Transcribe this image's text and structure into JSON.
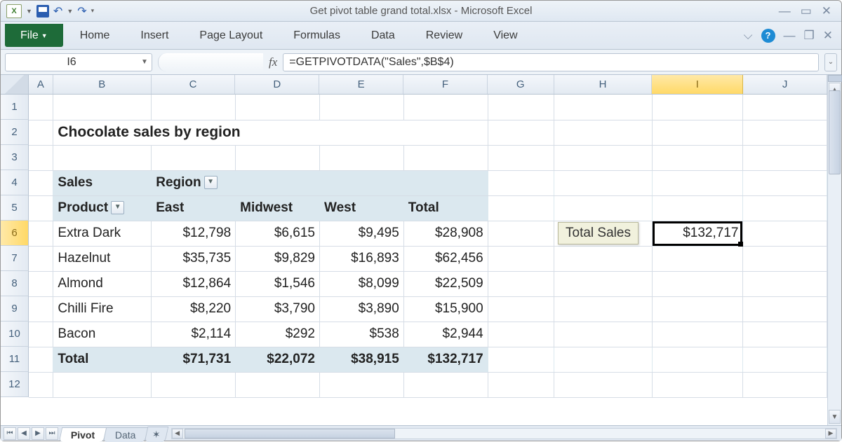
{
  "window": {
    "title": "Get pivot table grand total.xlsx  -  Microsoft Excel",
    "app_icon": "X"
  },
  "ribbon": {
    "file": "File",
    "tabs": [
      "Home",
      "Insert",
      "Page Layout",
      "Formulas",
      "Data",
      "Review",
      "View"
    ]
  },
  "namebox": "I6",
  "formula": "=GETPIVOTDATA(\"Sales\",$B$4)",
  "columns": [
    "A",
    "B",
    "C",
    "D",
    "E",
    "F",
    "G",
    "H",
    "I",
    "J"
  ],
  "rows": [
    "1",
    "2",
    "3",
    "4",
    "5",
    "6",
    "7",
    "8",
    "9",
    "10",
    "11",
    "12"
  ],
  "selected": {
    "col": "I",
    "row": "6"
  },
  "content": {
    "title": "Chocolate sales by region",
    "pivot": {
      "sales_label": "Sales",
      "region_label": "Region",
      "product_label": "Product",
      "col_headers": [
        "East",
        "Midwest",
        "West",
        "Total"
      ],
      "rows": [
        {
          "label": "Extra Dark",
          "vals": [
            "$12,798",
            "$6,615",
            "$9,495",
            "$28,908"
          ]
        },
        {
          "label": "Hazelnut",
          "vals": [
            "$35,735",
            "$9,829",
            "$16,893",
            "$62,456"
          ]
        },
        {
          "label": "Almond",
          "vals": [
            "$12,864",
            "$1,546",
            "$8,099",
            "$22,509"
          ]
        },
        {
          "label": "Chilli Fire",
          "vals": [
            "$8,220",
            "$3,790",
            "$3,890",
            "$15,900"
          ]
        },
        {
          "label": "Bacon",
          "vals": [
            "$2,114",
            "$292",
            "$538",
            "$2,944"
          ]
        }
      ],
      "total_label": "Total",
      "totals": [
        "$71,731",
        "$22,072",
        "$38,915",
        "$132,717"
      ]
    },
    "callout_label": "Total Sales",
    "callout_value": "$132,717"
  },
  "sheets": {
    "tabs": [
      "Pivot",
      "Data"
    ],
    "active": 0
  },
  "chart_data": {
    "type": "table",
    "title": "Chocolate sales by region",
    "columns": [
      "Product",
      "East",
      "Midwest",
      "West",
      "Total"
    ],
    "rows": [
      [
        "Extra Dark",
        12798,
        6615,
        9495,
        28908
      ],
      [
        "Hazelnut",
        35735,
        9829,
        16893,
        62456
      ],
      [
        "Almond",
        12864,
        1546,
        8099,
        22509
      ],
      [
        "Chilli Fire",
        8220,
        3790,
        3890,
        15900
      ],
      [
        "Bacon",
        2114,
        292,
        538,
        2944
      ],
      [
        "Total",
        71731,
        22072,
        38915,
        132717
      ]
    ],
    "grand_total": 132717
  }
}
